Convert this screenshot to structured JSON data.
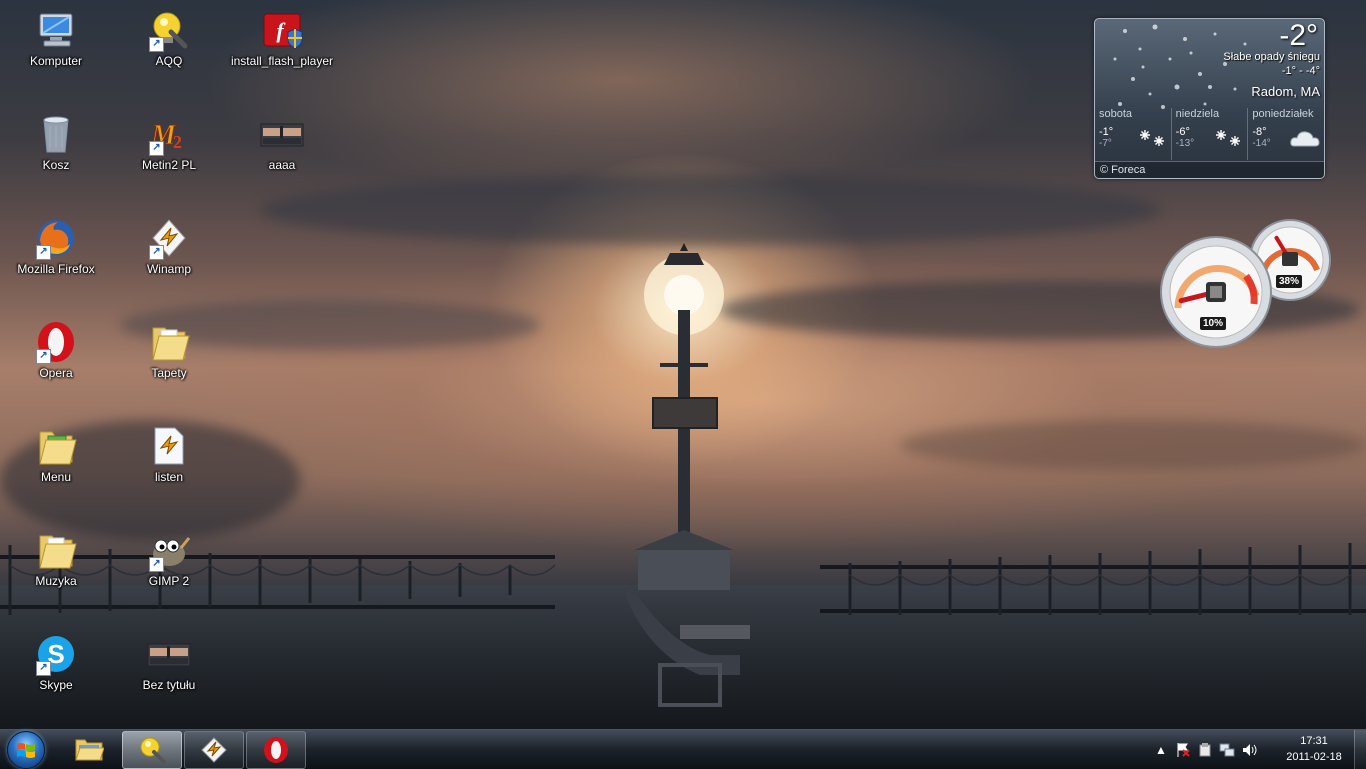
{
  "desktop": {
    "icons": [
      {
        "label": "Komputer",
        "icon": "computer-icon"
      },
      {
        "label": "Kosz",
        "icon": "recycle-bin-icon"
      },
      {
        "label": "Mozilla Firefox",
        "icon": "firefox-icon"
      },
      {
        "label": "Opera",
        "icon": "opera-icon"
      },
      {
        "label": "Menu",
        "icon": "folder-icon"
      },
      {
        "label": "Muzyka",
        "icon": "folder-icon"
      },
      {
        "label": "Skype",
        "icon": "skype-icon"
      },
      {
        "label": "AQQ",
        "icon": "aqq-icon"
      },
      {
        "label": "Metin2 PL",
        "icon": "metin2-icon"
      },
      {
        "label": "Winamp",
        "icon": "winamp-icon"
      },
      {
        "label": "Tapety",
        "icon": "folder-icon"
      },
      {
        "label": "listen",
        "icon": "winamp-playlist-icon"
      },
      {
        "label": "GIMP 2",
        "icon": "gimp-icon"
      },
      {
        "label": "Bez tytułu",
        "icon": "image-thumbnail-icon"
      },
      {
        "label": "install_flash_player",
        "icon": "flash-installer-icon"
      },
      {
        "label": "aaaa",
        "icon": "image-thumbnail-icon"
      }
    ]
  },
  "weather": {
    "temperature": "-2°",
    "condition": "Słabe opady śniegu",
    "range": "-1° - -4°",
    "city": "Radom, MA",
    "forecast": [
      {
        "day": "sobota",
        "high": "-1°",
        "low": "-7°",
        "icon": "snow-icon"
      },
      {
        "day": "niedziela",
        "high": "-6°",
        "low": "-13°",
        "icon": "snow-icon"
      },
      {
        "day": "poniedziałek",
        "high": "-8°",
        "low": "-14°",
        "icon": "cloud-icon"
      }
    ],
    "footer": "© Foreca"
  },
  "meter": {
    "cpu_label": "10%",
    "cpu_value": 0.1,
    "ram_label": "38%",
    "ram_value": 0.38
  },
  "taskbar": {
    "pinned": [
      {
        "name": "explorer",
        "icon": "folder-icon",
        "state": "pinned"
      },
      {
        "name": "aqq",
        "icon": "aqq-icon",
        "state": "active"
      },
      {
        "name": "winamp",
        "icon": "winamp-icon",
        "state": "open"
      },
      {
        "name": "opera",
        "icon": "opera-icon",
        "state": "open"
      }
    ],
    "tray": {
      "icons": [
        "show-hidden-icons-icon",
        "action-center-icon",
        "device-icon",
        "network-icon",
        "volume-icon"
      ]
    },
    "clock": {
      "time": "17:31",
      "date": "2011-02-18"
    }
  }
}
